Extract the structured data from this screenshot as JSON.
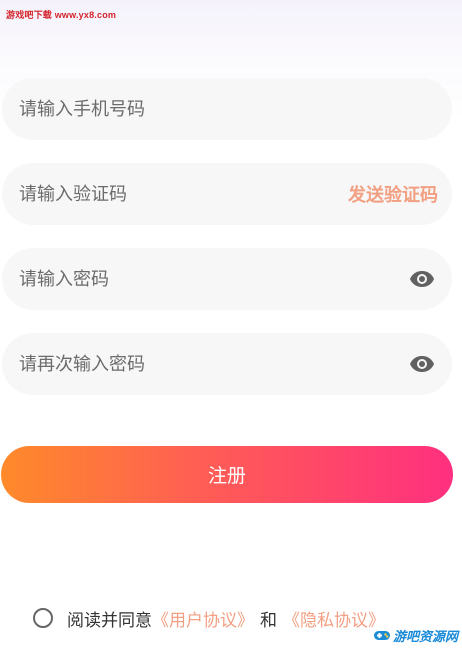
{
  "watermark_top": "游戏吧下载 www.yx8.com",
  "form": {
    "phone_placeholder": "请输入手机号码",
    "code_placeholder": "请输入验证码",
    "send_code_label": "发送验证码",
    "password_placeholder": "请输入密码",
    "confirm_password_placeholder": "请再次输入密码",
    "password_toggle_icon": "eye-icon",
    "confirm_toggle_icon": "eye-icon"
  },
  "register_button_label": "注册",
  "agreement": {
    "checked": false,
    "prefix": "阅读并同意",
    "user_agreement_label": "《用户协议》",
    "and_label": "和",
    "privacy_policy_label": "《隐私协议》"
  },
  "watermark_bottom": "游吧资源网",
  "colors": {
    "accent_text": "#f29f82",
    "button_gradient_start": "#ff8a2a",
    "button_gradient_end": "#ff2f7f",
    "field_background": "#f7f7f7"
  }
}
